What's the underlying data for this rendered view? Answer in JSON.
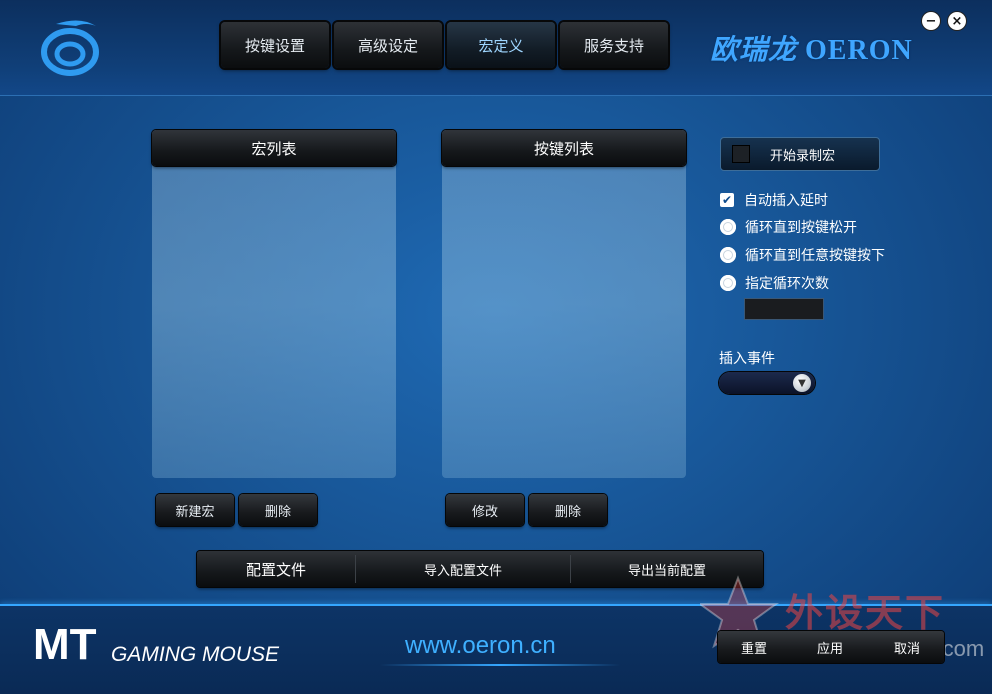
{
  "nav": {
    "tabs": [
      {
        "label": "按键设置"
      },
      {
        "label": "高级设定"
      },
      {
        "label": "宏定义"
      },
      {
        "label": "服务支持"
      }
    ],
    "active_tab": "宏定义"
  },
  "brand": {
    "cn": "欧瑞龙",
    "en": "OERON"
  },
  "window": {
    "minimize_label": "−",
    "close_label": "×"
  },
  "macro_list": {
    "title": "宏列表",
    "new_button": "新建宏",
    "delete_button": "删除"
  },
  "key_list": {
    "title": "按键列表",
    "edit_button": "修改",
    "delete_button": "删除"
  },
  "options": {
    "record_button": "开始录制宏",
    "auto_insert_delay": {
      "label": "自动插入延时",
      "checked": true
    },
    "loops": [
      {
        "label": "循环直到按键松开"
      },
      {
        "label": "循环直到任意按键按下"
      },
      {
        "label": "指定循环次数"
      }
    ],
    "loop_count_value": "",
    "insert_event_label": "插入事件",
    "insert_event_value": ""
  },
  "config_bar": {
    "title": "配置文件",
    "import_label": "导入配置文件",
    "export_label": "导出当前配置"
  },
  "footer": {
    "product_mt": "MT",
    "product_sub": "GAMING MOUSE",
    "url": "www.oeron.cn",
    "reset_label": "重置",
    "apply_label": "应用",
    "cancel_label": "取消"
  },
  "watermark": {
    "cn": "外设天下",
    "url": "www.wstx.com"
  },
  "colors": {
    "accent": "#35a7ff",
    "brand": "#3fa6ff",
    "background": "#175596"
  }
}
